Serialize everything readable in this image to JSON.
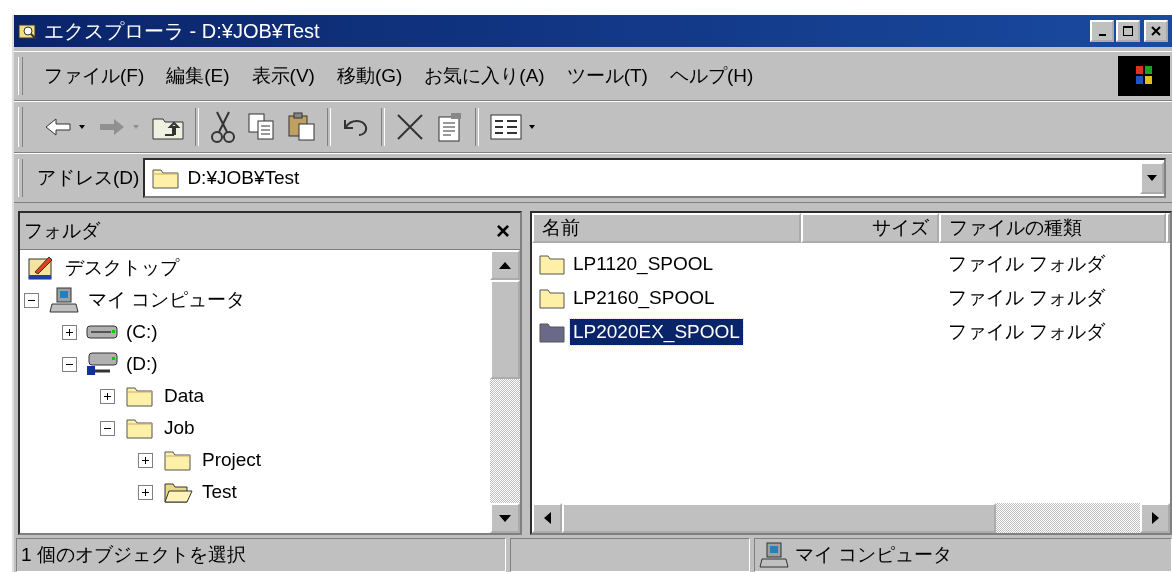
{
  "window": {
    "title": "エクスプローラ - D:¥JOB¥Test"
  },
  "menu": [
    "ファイル(F)",
    "編集(E)",
    "表示(V)",
    "移動(G)",
    "お気に入り(A)",
    "ツール(T)",
    "ヘルプ(H)"
  ],
  "address": {
    "label": "アドレス(D)",
    "value": "D:¥JOB¥Test"
  },
  "folder_pane": {
    "title": "フォルダ",
    "close": "×"
  },
  "tree": [
    {
      "label": "デスクトップ",
      "kind": "desktop",
      "children": [
        {
          "label": "マイ コンピュータ",
          "kind": "computer",
          "expanded": true,
          "children": [
            {
              "label": "(C:)",
              "kind": "drive",
              "expanded": false
            },
            {
              "label": "(D:)",
              "kind": "netdrive",
              "expanded": true,
              "children": [
                {
                  "label": "Data",
                  "kind": "folder",
                  "expanded": false
                },
                {
                  "label": "Job",
                  "kind": "folder",
                  "expanded": true,
                  "children": [
                    {
                      "label": "Project",
                      "kind": "folder",
                      "expanded": false
                    },
                    {
                      "label": "Test",
                      "kind": "open-folder",
                      "expanded": false
                    }
                  ]
                }
              ]
            }
          ]
        }
      ]
    }
  ],
  "columns": [
    "名前",
    "サイズ",
    "ファイルの種類"
  ],
  "files": [
    {
      "name": "LP1120_SPOOL",
      "type": "ファイル フォルダ",
      "selected": false
    },
    {
      "name": "LP2160_SPOOL",
      "type": "ファイル フォルダ",
      "selected": false
    },
    {
      "name": "LP2020EX_SPOOL",
      "type": "ファイル フォルダ",
      "selected": true
    }
  ],
  "status_bar": {
    "selection": "1 個のオブジェクトを選択",
    "zone": "マイ コンピュータ"
  }
}
